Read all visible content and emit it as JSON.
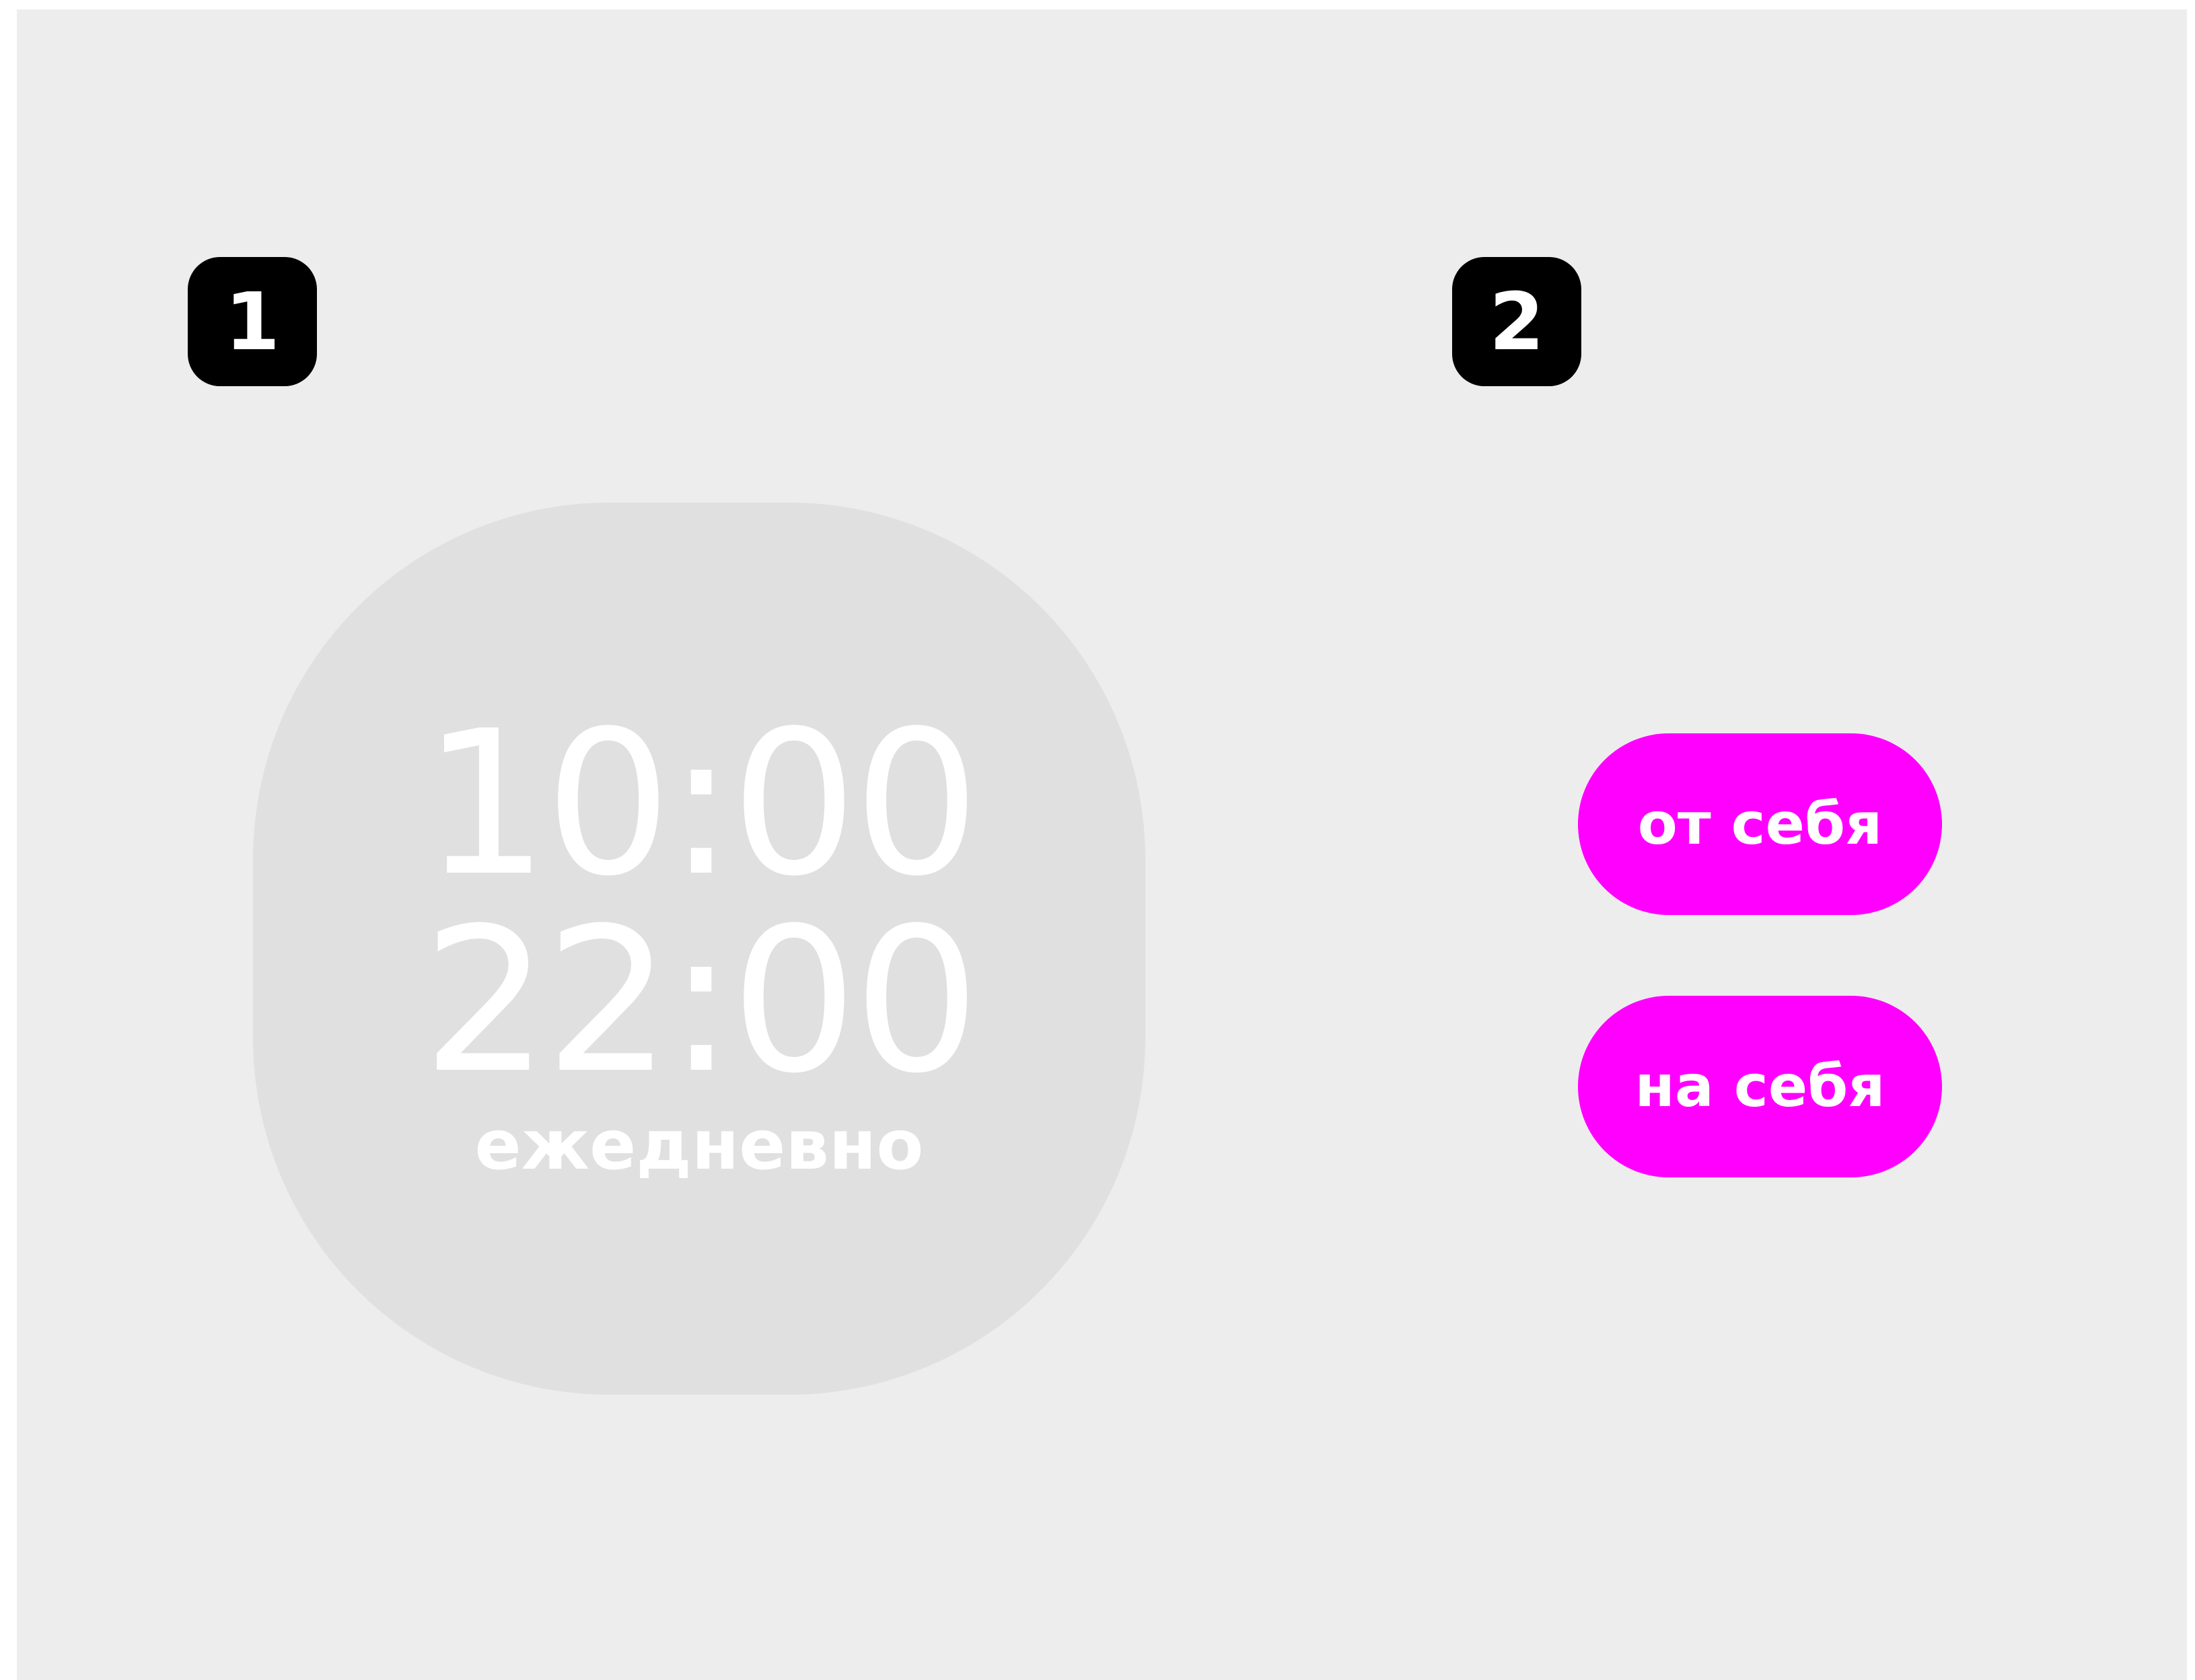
{
  "badges": {
    "first": "1",
    "second": "2"
  },
  "schedule": {
    "time_start": "10:00",
    "time_end": "22:00",
    "frequency": "ежедневно"
  },
  "buttons": {
    "pull_label": "от себя",
    "push_label": "на себя"
  },
  "colors": {
    "background": "#ededed",
    "card": "#e0e0e0",
    "badge": "#000000",
    "accent": "#ff00ff",
    "text": "#ffffff"
  }
}
